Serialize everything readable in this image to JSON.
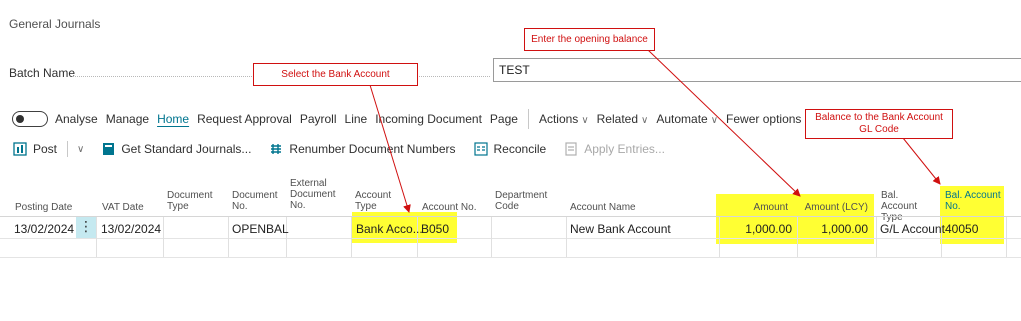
{
  "page": {
    "title": "General Journals"
  },
  "batch": {
    "label": "Batch Name",
    "value": "TEST"
  },
  "menu": {
    "analyse": "Analyse",
    "items": [
      "Manage",
      "Home",
      "Request Approval",
      "Payroll",
      "Line",
      "Incoming Document",
      "Page"
    ],
    "actions": "Actions",
    "related": "Related",
    "automate": "Automate",
    "fewer": "Fewer options"
  },
  "toolbar": {
    "post": "Post",
    "get_standard": "Get Standard Journals...",
    "renumber": "Renumber Document Numbers",
    "reconcile": "Reconcile",
    "apply_entries": "Apply Entries..."
  },
  "columns": {
    "posting_date": "Posting Date",
    "vat_date": "VAT Date",
    "document_type": "Document Type",
    "document_no": "Document No.",
    "external_document_no": "External Document No.",
    "account_type": "Account Type",
    "account_no": "Account No.",
    "department_code": "Department Code",
    "account_name": "Account Name",
    "amount": "Amount",
    "amount_lcy": "Amount (LCY)",
    "bal_account_type": "Bal. Account Type",
    "bal_account_no": "Bal. Account No."
  },
  "row": {
    "posting_date": "13/02/2024",
    "vat_date": "13/02/2024",
    "document_no": "OPENBAL",
    "account_type": "Bank Acco...",
    "account_no": "B050",
    "account_name": "New Bank Account",
    "amount": "1,000.00",
    "amount_lcy": "1,000.00",
    "bal_account_type": "G/L Account",
    "bal_account_no": "40050"
  },
  "callouts": {
    "select_bank": "Select the Bank Account",
    "opening_balance": "Enter the opening balance",
    "balance_gl_line1": "Balance to the Bank Account",
    "balance_gl_line2": "GL Code"
  },
  "colors": {
    "accent": "#00758f",
    "highlight": "#ffff33",
    "callout": "#d01010"
  }
}
